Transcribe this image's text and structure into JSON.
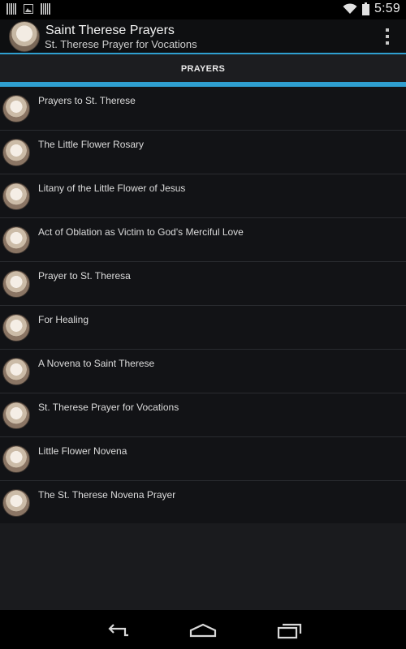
{
  "status_bar": {
    "time": "5:59",
    "left_icons": [
      "barcode-icon",
      "image-icon",
      "barcode-icon"
    ],
    "right_icons": [
      "wifi-icon",
      "battery-icon"
    ]
  },
  "action_bar": {
    "title": "Saint Therese Prayers",
    "subtitle": "St. Therese Prayer for Vocations",
    "accent_color": "#2f9fd0"
  },
  "tabs": [
    {
      "label": "PRAYERS",
      "selected": true
    }
  ],
  "list": {
    "items": [
      {
        "label": "Prayers to St. Therese"
      },
      {
        "label": "The Little Flower Rosary"
      },
      {
        "label": "Litany of the Little Flower of Jesus"
      },
      {
        "label": "Act of Oblation as Victim to God's Merciful Love"
      },
      {
        "label": "Prayer to St. Theresa"
      },
      {
        "label": "For Healing"
      },
      {
        "label": "A Novena to Saint Therese"
      },
      {
        "label": "St. Therese Prayer for Vocations"
      },
      {
        "label": "Little Flower Novena"
      },
      {
        "label": "The St. Therese Novena Prayer"
      }
    ]
  },
  "nav_bar": {
    "buttons": [
      "back-icon",
      "home-icon",
      "recents-icon"
    ]
  }
}
